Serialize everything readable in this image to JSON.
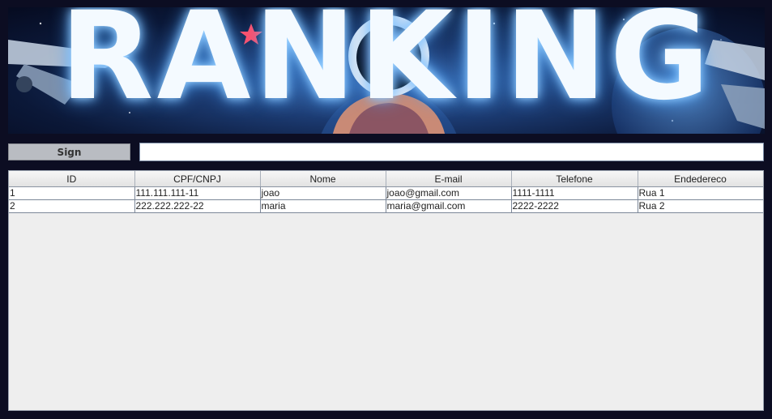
{
  "banner": {
    "title": "RANKING"
  },
  "sign": {
    "button_label": "Sign",
    "input_value": "",
    "input_placeholder": ""
  },
  "table": {
    "columns": [
      "ID",
      "CPF/CNPJ",
      "Nome",
      "E-mail",
      "Telefone",
      "Endedereco"
    ],
    "rows": [
      [
        "1",
        "111.111.111-11",
        "joao",
        "joao@gmail.com",
        "1111-1111",
        "Rua 1"
      ],
      [
        "2",
        "222.222.222-22",
        "maria",
        "maria@gmail.com",
        "2222-2222",
        "Rua 2"
      ]
    ]
  },
  "colors": {
    "background": "#0c0d22",
    "panel": "#eeeeee",
    "button": "#b9bcc2"
  }
}
